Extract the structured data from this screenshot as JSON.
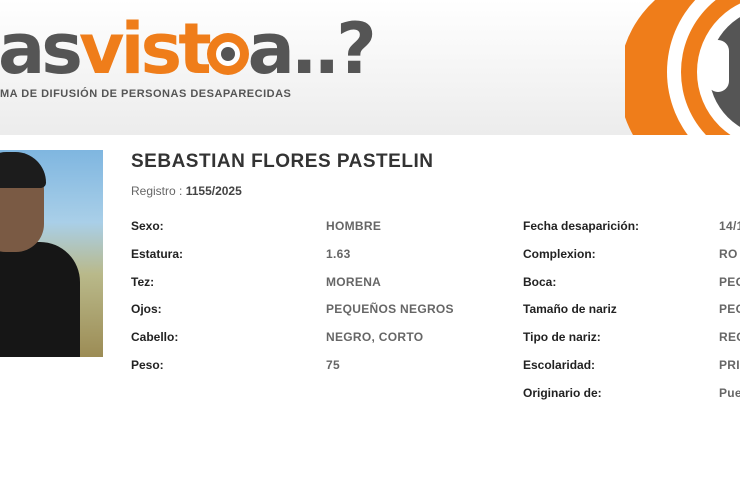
{
  "logo": {
    "part1": "as",
    "part2": "vist",
    "part3": "a..?",
    "tagline": "MA DE DIFUSIÓN DE PERSONAS DESAPARECIDAS"
  },
  "colors": {
    "accent": "#ef7d1a",
    "logo_gray": "#555555"
  },
  "person": {
    "name": "SEBASTIAN FLORES PASTELIN",
    "registro_label": "Registro :",
    "registro_value": "1155/2025",
    "photo_icon": "person-photo"
  },
  "details_left": [
    {
      "label": "Sexo:",
      "value": "HOMBRE"
    },
    {
      "label": "Estatura:",
      "value": "1.63"
    },
    {
      "label": "Tez:",
      "value": "MORENA"
    },
    {
      "label": "Ojos:",
      "value": "PEQUEÑOS NEGROS"
    },
    {
      "label": "Cabello:",
      "value": "NEGRO, CORTO"
    },
    {
      "label": "Peso:",
      "value": "75"
    }
  ],
  "details_right": [
    {
      "label": "Fecha desaparición:",
      "value": "14/1"
    },
    {
      "label": "Complexion:",
      "value": "RO"
    },
    {
      "label": "Boca:",
      "value": "PEC"
    },
    {
      "label": "Tamaño de nariz",
      "value": "PEC"
    },
    {
      "label": "Tipo de nariz:",
      "value": "REC"
    },
    {
      "label": "Escolaridad:",
      "value": "PRI"
    },
    {
      "label": "Originario de:",
      "value": "Pue"
    }
  ]
}
